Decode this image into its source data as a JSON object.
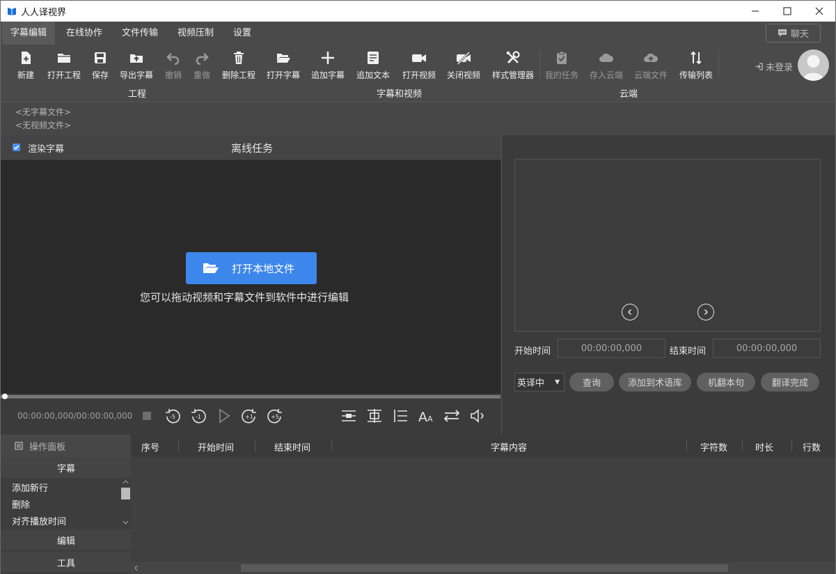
{
  "app": {
    "title": "人人译视界"
  },
  "menu": {
    "items": [
      "字幕编辑",
      "在线协作",
      "文件传输",
      "视频压制",
      "设置"
    ],
    "chat_label": "聊天"
  },
  "toolbar": {
    "tools": [
      {
        "label": "新建",
        "icon": "new-file-icon"
      },
      {
        "label": "打开工程",
        "icon": "folder-icon"
      },
      {
        "label": "保存",
        "icon": "save-icon"
      },
      {
        "label": "导出字幕",
        "icon": "export-icon"
      },
      {
        "label": "撤销",
        "icon": "undo-icon"
      },
      {
        "label": "重做",
        "icon": "redo-icon"
      },
      {
        "label": "删除工程",
        "icon": "trash-icon"
      },
      {
        "label": "打开字幕",
        "icon": "open-folder-icon"
      },
      {
        "label": "追加字幕",
        "icon": "plus-icon"
      },
      {
        "label": "追加文本",
        "icon": "text-doc-icon"
      },
      {
        "label": "打开视频",
        "icon": "camera-icon"
      },
      {
        "label": "关闭视频",
        "icon": "camera-off-icon"
      },
      {
        "label": "样式管理器",
        "icon": "tools-icon"
      },
      {
        "label": "我的任务",
        "icon": "clipboard-icon"
      },
      {
        "label": "存入云端",
        "icon": "cloud-save-icon"
      },
      {
        "label": "云端文件",
        "icon": "cloud-upload-icon"
      },
      {
        "label": "传输列表",
        "icon": "transfer-icon"
      }
    ],
    "groups": [
      "工程",
      "字幕和视频",
      "云端"
    ],
    "login_label": "未登录"
  },
  "files": {
    "subtitle": "<无字幕文件>",
    "video": "<无视频文件>"
  },
  "video": {
    "render_label": "渲染字幕",
    "title": "离线任务",
    "open_button": "打开本地文件",
    "hint": "您可以拖动视频和字幕文件到软件中进行编辑",
    "time": "00:00:00,000/00:00:00,000",
    "controls": [
      "stop-icon",
      "rewind-5-icon",
      "rewind-1-icon",
      "play-icon",
      "forward-1-icon",
      "forward-5-icon",
      "align-center-icon",
      "align-middle-icon",
      "line-spacing-icon",
      "font-size-icon",
      "swap-icon",
      "volume-icon"
    ]
  },
  "translate": {
    "start_label": "开始时间",
    "start_value": "00:00:00,000",
    "end_label": "结束时间",
    "end_value": "00:00:00,000",
    "lang": "英译中",
    "buttons": [
      "查询",
      "添加到术语库",
      "机翻本句",
      "翻译完成"
    ]
  },
  "ops": {
    "title": "操作面板",
    "section_subtitle": "字幕",
    "items": [
      "添加新行",
      "删除",
      "对齐播放时间"
    ],
    "section_edit": "编辑",
    "section_tools": "工具"
  },
  "table": {
    "columns": [
      "序号",
      "开始时间",
      "结束时间",
      "字幕内容",
      "字符数",
      "时长",
      "行数"
    ]
  },
  "colors": {
    "accent": "#3d87ec",
    "panel": "#3b3b3b",
    "video_bg": "#2a2a2a"
  }
}
